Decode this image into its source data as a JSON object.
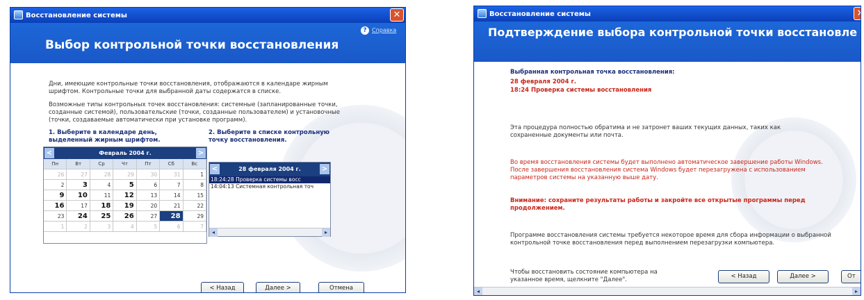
{
  "left": {
    "title": "Восстановление системы",
    "help_label": "Справка",
    "heading": "Выбор контрольной точки восстановления",
    "para1": "Дни, имеющие контрольные точки восстановления, отображаются в календаре жирным шрифтом. Контрольные точки для выбранной даты содержатся в списке.",
    "para2": "Возможные типы контрольных точек восстановления: системные (запланированные точки, созданные системой), пользовательские (точки, созданные пользователем) и установочные (точки, создаваемые автоматически при установке программ).",
    "step1": "1. Выберите в календаре день, выделенный жирным шрифтом.",
    "step2": "2. Выберите в списке контрольную точку восстановления.",
    "calendar": {
      "month": "Февраль 2004 г.",
      "dow": [
        "Пн",
        "Вт",
        "Ср",
        "Чт",
        "Пт",
        "Сб",
        "Вс"
      ],
      "weeks": [
        [
          "26",
          "27",
          "28",
          "29",
          "30",
          "31",
          "1"
        ],
        [
          "2",
          "3",
          "4",
          "5",
          "6",
          "7",
          "8"
        ],
        [
          "9",
          "10",
          "11",
          "12",
          "13",
          "14",
          "15"
        ],
        [
          "16",
          "17",
          "18",
          "19",
          "20",
          "21",
          "22"
        ],
        [
          "23",
          "24",
          "25",
          "26",
          "27",
          "28",
          "29"
        ],
        [
          "1",
          "2",
          "3",
          "4",
          "5",
          "6",
          "7"
        ]
      ]
    },
    "list": {
      "date_header": "28 февраля 2004 г.",
      "items": [
        "18:24:28  Проверка системы восс",
        "14:04:13  Системная контрольная точ"
      ]
    },
    "buttons": {
      "back": "< Назад",
      "next": "Далее >",
      "cancel": "Отмена"
    }
  },
  "right": {
    "title": "Восстановление системы",
    "heading": "Подтверждение выбора контрольной точки восстановле",
    "selected_label": "Выбранная контрольная точка восстановления:",
    "selected_date": "28 февраля 2004 г.",
    "selected_point": "18:24 Проверка системы восстановления",
    "para_reversible": "Эта процедура полностью обратима и не затронет ваших текущих данных, таких как сохраненные документы или почта.",
    "para_restart": "Во время восстановления системы будет выполнено автоматическое завершение работы Windows. После завершения восстановления система Windows будет перезагружена с использованием параметров системы на указанную выше дату.",
    "warning": "Внимание: сохраните результаты работы и закройте все открытые программы перед продолжением.",
    "para_time": "Программе восстановления системы требуется некоторое время для сбора информации о выбранной контрольной точке восстановления перед выполнением перезагрузки компьютера.",
    "para_hint": "Чтобы восстановить состояние компьютера на указанное время, щелкните \"Далее\".",
    "buttons": {
      "back": "< Назад",
      "next": "Далее >",
      "cancel": "От"
    }
  }
}
